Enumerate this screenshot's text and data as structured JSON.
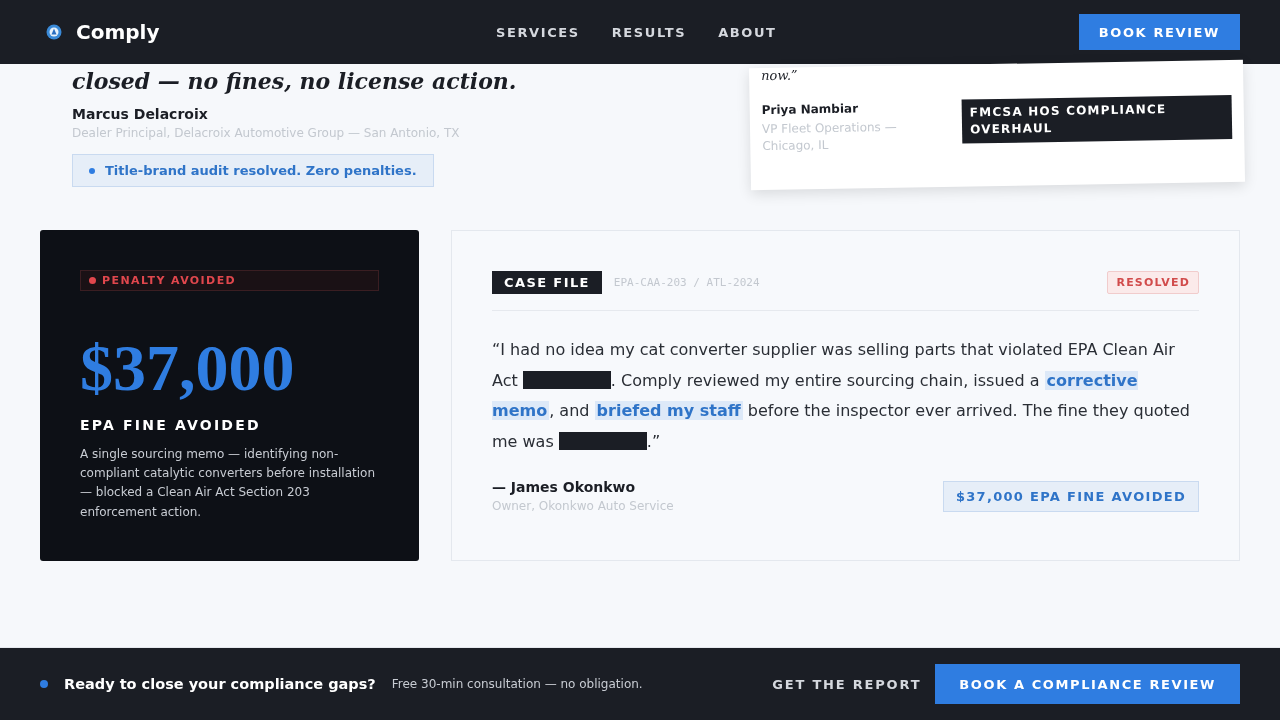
{
  "header": {
    "brand": "Comply",
    "nav": [
      {
        "label": "SERVICES"
      },
      {
        "label": "RESULTS"
      },
      {
        "label": "ABOUT"
      }
    ],
    "cta": "BOOK REVIEW"
  },
  "featured": {
    "headline": "closed — no fines, no license action.",
    "name": "Marcus Delacroix",
    "role": "Dealer Principal, Delacroix Automotive Group — San Antonio, TX",
    "result": "Title-brand audit resolved. Zero penalties."
  },
  "side_card": {
    "quote_end": "now.”",
    "name": "Priya Nambiar",
    "role": "VP Fleet Operations — Chicago, IL",
    "tag": "FMCSA HOS COMPLIANCE OVERHAUL"
  },
  "stat_card": {
    "badge": "PENALTY AVOIDED",
    "amount": "$37,000",
    "label": "EPA FINE AVOIDED",
    "description": "A single sourcing memo — identifying non-compliant catalytic converters before installation — blocked a Clean Air Act Section 203 enforcement action."
  },
  "case_card": {
    "tag": "CASE FILE",
    "reference": "EPA-CAA-203 / ATL-2024",
    "status": "RESOLVED",
    "quote": [
      {
        "kind": "text",
        "text": "“I had no idea my cat converter supplier was selling parts that violated EPA Clean Air Act "
      },
      {
        "kind": "redacted"
      },
      {
        "kind": "text",
        "text": ". Comply reviewed my entire sourcing chain, issued a "
      },
      {
        "kind": "highlight",
        "text": "corrective memo"
      },
      {
        "kind": "text",
        "text": ", and "
      },
      {
        "kind": "highlight",
        "text": "briefed my staff"
      },
      {
        "kind": "text",
        "text": " before the inspector ever arrived. The fine they quoted me was "
      },
      {
        "kind": "redacted"
      },
      {
        "kind": "text",
        "text": ".”"
      }
    ],
    "author": "— James Okonkwo",
    "author_role": "Owner, Okonkwo Auto Service",
    "outcome": "$37,000 EPA FINE AVOIDED"
  },
  "footer_bar": {
    "title": "Ready to close your compliance gaps?",
    "subtitle": "Free 30-min consultation — no obligation.",
    "link": "GET THE REPORT",
    "cta": "BOOK A COMPLIANCE REVIEW"
  }
}
